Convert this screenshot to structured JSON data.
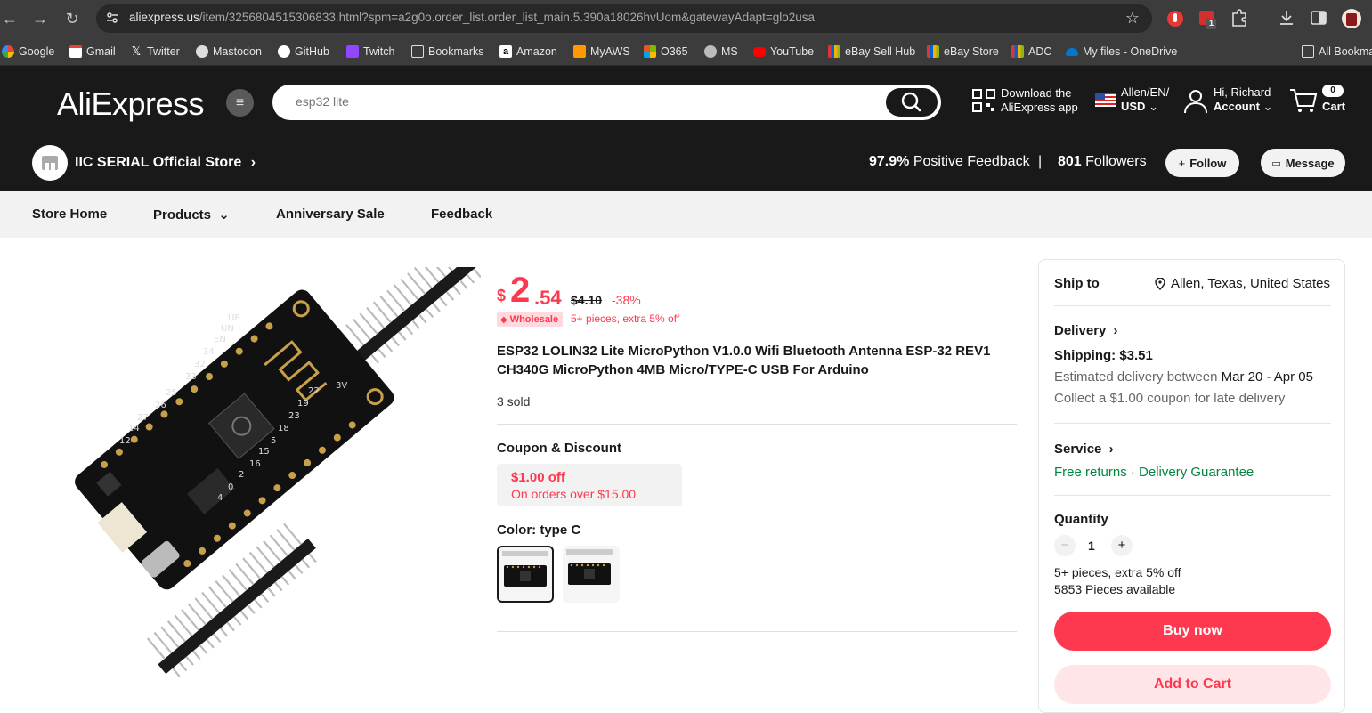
{
  "browser": {
    "url_main": "aliexpress.us",
    "url_rest": "/item/3256804515306833.html?spm=a2g0o.order_list.order_list_main.5.390a18026hvUom&gatewayAdapt=glo2usa",
    "bookmarks": [
      {
        "label": "Google",
        "color": "#ffffff"
      },
      {
        "label": "Gmail",
        "color": "#ea4335"
      },
      {
        "label": "Twitter",
        "color": "#000000"
      },
      {
        "label": "Mastodon",
        "color": "#dddddd"
      },
      {
        "label": "GitHub",
        "color": "#ffffff"
      },
      {
        "label": "Twitch",
        "color": "#9146ff"
      },
      {
        "label": "Bookmarks",
        "color": "folder"
      },
      {
        "label": "Amazon",
        "color": "#ffffff"
      },
      {
        "label": "MyAWS",
        "color": "#ff9900"
      },
      {
        "label": "O365",
        "color": "#f25022"
      },
      {
        "label": "MS",
        "color": "#dddddd"
      },
      {
        "label": "YouTube",
        "color": "#ff0000"
      },
      {
        "label": "eBay Sell Hub",
        "color": "#e53238"
      },
      {
        "label": "eBay Store",
        "color": "#e53238"
      },
      {
        "label": "ADC",
        "color": "#e53238"
      },
      {
        "label": "My files - OneDrive",
        "color": "#0078d4"
      }
    ],
    "all_bookmarks": "All Bookmarks",
    "extension_badge": "1"
  },
  "header": {
    "logo": "AliExpress",
    "search_placeholder": "esp32 lite",
    "download_line1": "Download the",
    "download_line2": "AliExpress app",
    "locale_line1": "Allen/EN/",
    "locale_line2": "USD",
    "account_line1": "Hi, Richard",
    "account_line2": "Account",
    "cart_count": "0",
    "cart_label": "Cart"
  },
  "store": {
    "name": "IIC SERIAL Official Store",
    "feedback_pct": "97.9%",
    "feedback_label": "Positive Feedback",
    "followers_count": "801",
    "followers_label": "Followers",
    "follow_label": "Follow",
    "message_label": "Message",
    "nav": [
      "Store Home",
      "Products",
      "Anniversary Sale",
      "Feedback"
    ]
  },
  "product": {
    "currency": "$",
    "price_int": "2",
    "price_dec": ".54",
    "price_old": "$4.10",
    "discount": "-38%",
    "wholesale_badge": "Wholesale",
    "wholesale_text": "5+ pieces, extra 5% off",
    "title": "ESP32 LOLIN32 Lite MicroPython V1.0.0 Wifi Bluetooth Antenna ESP-32 REV1 CH340G MicroPython 4MB Micro/TYPE-C USB For Arduino",
    "sold": "3 sold",
    "coupon_heading": "Coupon & Discount",
    "coupon_amount": "$1.00 off",
    "coupon_condition": "On orders over $15.00",
    "color_heading": "Color: type C",
    "board_pins_left": [
      "UP",
      "UN",
      "EN",
      "34",
      "32",
      "33",
      "25",
      "26",
      "27",
      "14",
      "12"
    ],
    "board_pins_right": [
      "3V",
      "22",
      "19",
      "23",
      "18",
      "5",
      "15",
      "16",
      "2",
      "0",
      "4"
    ]
  },
  "panel": {
    "ship_to_label": "Ship to",
    "ship_to_value": "Allen, Texas, United States",
    "delivery_label": "Delivery",
    "shipping": "Shipping: $3.51",
    "estimated_prefix": "Estimated delivery between ",
    "estimated_dates": "Mar 20 - Apr 05",
    "late_coupon": "Collect a $1.00 coupon for late delivery",
    "service_label": "Service",
    "service_free_returns": "Free returns",
    "service_dot": " · ",
    "service_guarantee": "Delivery Guarantee",
    "quantity_label": "Quantity",
    "quantity_value": "1",
    "qty_minus": "−",
    "qty_plus": "+",
    "extra_off": "5+ pieces, extra 5% off",
    "available": "5853 Pieces available",
    "buy_now": "Buy now",
    "add_to_cart": "Add to Cart"
  }
}
